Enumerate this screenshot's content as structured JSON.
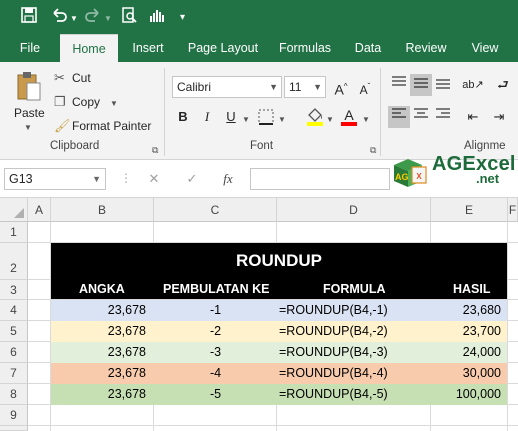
{
  "colors": {
    "excel_green": "#217346",
    "title_bg": "#000000",
    "row_colors": [
      "#dae3f3",
      "#fff2cc",
      "#e2efda",
      "#f8cbad",
      "#c6e0b4"
    ]
  },
  "qat": {
    "icons": [
      "save-icon",
      "undo-icon",
      "redo-icon",
      "print-preview-icon",
      "touch-mode-icon",
      "customize-icon"
    ]
  },
  "tabs": [
    "File",
    "Home",
    "Insert",
    "Page Layout",
    "Formulas",
    "Data",
    "Review",
    "View"
  ],
  "ribbon": {
    "clipboard": {
      "paste": "Paste",
      "cut": "Cut",
      "copy": "Copy",
      "format_painter": "Format Painter",
      "label": "Clipboard"
    },
    "font": {
      "name": "Calibri",
      "size": "11",
      "bold": "B",
      "italic": "I",
      "underline": "U",
      "grow": "A",
      "shrink": "A",
      "font_color": "A",
      "label": "Font"
    },
    "alignment": {
      "label": "Alignme"
    }
  },
  "formula_bar": {
    "name_box": "G13",
    "cancel": "✕",
    "enter": "✓",
    "fx": "fx",
    "value": ""
  },
  "logo": {
    "text": "AGExcel",
    "sub": ".net",
    "badge": "AG"
  },
  "grid": {
    "columns": [
      "A",
      "B",
      "C",
      "D",
      "E",
      "F"
    ],
    "rows": [
      "1",
      "2",
      "3",
      "4",
      "5",
      "6",
      "7",
      "8",
      "9"
    ]
  },
  "table": {
    "title": "ROUNDUP",
    "headers": [
      "ANGKA",
      "PEMBULATAN KE",
      "FORMULA",
      "HASIL"
    ],
    "rows": [
      {
        "angka": "23,678",
        "pembulatan": "-1",
        "formula": "=ROUNDUP(B4,-1)",
        "hasil": "23,680"
      },
      {
        "angka": "23,678",
        "pembulatan": "-2",
        "formula": "=ROUNDUP(B4,-2)",
        "hasil": "23,700"
      },
      {
        "angka": "23,678",
        "pembulatan": "-3",
        "formula": "=ROUNDUP(B4,-3)",
        "hasil": "24,000"
      },
      {
        "angka": "23,678",
        "pembulatan": "-4",
        "formula": "=ROUNDUP(B4,-4)",
        "hasil": "30,000"
      },
      {
        "angka": "23,678",
        "pembulatan": "-5",
        "formula": "=ROUNDUP(B4,-5)",
        "hasil": "100,000"
      }
    ]
  }
}
